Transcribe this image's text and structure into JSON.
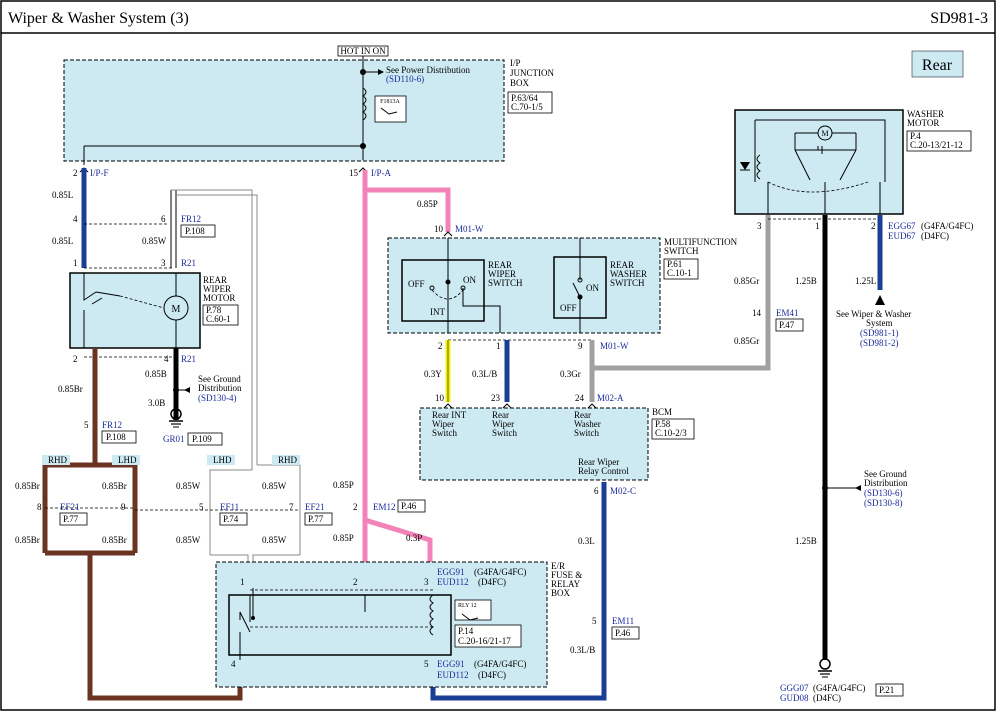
{
  "header": {
    "title": "Wiper & Washer System (3)",
    "code": "SD981-3"
  },
  "rear_label": "Rear",
  "hot_in_on": "HOT IN ON",
  "ip_box": {
    "name": [
      "I/P",
      "JUNCTION",
      "BOX"
    ],
    "ref": [
      "P.63/64",
      "C.70-1/5"
    ],
    "fuse": "F1813A",
    "see_power": "See Power Distribution",
    "see_power_ref": "(SD110-6)"
  },
  "pins": {
    "ipf": "I/P-F",
    "ipa": "I/P-A",
    "fr12_top": "FR12",
    "r21_top": "R21",
    "r21_bot": "R21",
    "fr12_bot": "FR12",
    "m01w_top": "M01-W",
    "m01w_bot": "M01-W",
    "em41": "EM41",
    "m02a": "M02-A",
    "m02c": "M02-C",
    "ef21_l": "EF21",
    "ef11": "EF11",
    "ef21_r": "EF21",
    "em12": "EM12",
    "em11": "EM11",
    "egg67": "EGG67",
    "egg67_v": "(G4FA/G4FC)",
    "eud67": "EUD67",
    "eud67_v": "(D4FC)",
    "egg91_top": "EGG91",
    "egg91_top_v": "(G4FA/G4FC)",
    "eud112_top": "EUD112",
    "eud112_top_v": "(D4FC)",
    "egg91_bot": "EGG91",
    "egg91_bot_v": "(G4FA/G4FC)",
    "eud112_bot": "EUD112",
    "eud112_bot_v": "(D4FC)",
    "ggg07": "GGG07",
    "ggg07_v": "(G4FA/G4FC)",
    "gud08": "GUD08",
    "gud08_v": "(D4FC)",
    "gr01": "GR01"
  },
  "refs": {
    "p108_top": "P.108",
    "p108_bot": "P.108",
    "p47": "P.47",
    "p109": "P.109",
    "p77_l": "P.77",
    "p74": "P.74",
    "p77_r": "P.77",
    "p46_top": "P.46",
    "p46_bot": "P.46",
    "p21": "P.21"
  },
  "numbers": [
    "2",
    "15",
    "4",
    "6",
    "1",
    "3",
    "2",
    "4",
    "5",
    "10",
    "2",
    "1",
    "9",
    "10",
    "23",
    "24",
    "6",
    "3",
    "1",
    "2",
    "14",
    "8",
    "9",
    "5",
    "7",
    "2",
    "1",
    "2",
    "3",
    "4",
    "5",
    "5",
    "RHD",
    "LHD",
    "LHD",
    "RHD"
  ],
  "wires": {
    "w085L_a": "0.85L",
    "w085L_b": "0.85L",
    "w085W_a": "0.85W",
    "w085B": "0.85B",
    "w30B": "3.0B",
    "w085Br_a": "0.85Br",
    "w085P_a": "0.85P",
    "w03Y": "0.3Y",
    "w03LB_a": "0.3L/B",
    "w03Gr": "0.3Gr",
    "w085Gr_a": "0.85Gr",
    "w085Gr_b": "0.85Gr",
    "w125B_a": "1.25B",
    "w125L": "1.25L",
    "w125B_b": "1.25B",
    "w03L": "0.3L",
    "w03LB_b": "0.3L/B",
    "w085Br_b": "0.85Br",
    "w085Br_c": "0.85Br",
    "w085W_b": "0.85W",
    "w085W_c": "0.85W",
    "w085Br_d": "0.85Br",
    "w085Br_e": "0.85Br",
    "w085W_d": "0.85W",
    "w085W_e": "0.85W",
    "w085P_b": "0.85P",
    "w085P_c": "0.85P",
    "w03P": "0.3P"
  },
  "motor": {
    "name": [
      "REAR",
      "WIPER",
      "MOTOR"
    ],
    "ref": [
      "P.78",
      "C.60-1"
    ],
    "m": "M"
  },
  "ground1": {
    "see": [
      "See Ground",
      "Distribution"
    ],
    "ref": "(SD130-4)"
  },
  "multifunction": {
    "name": [
      "MULTIFUNCTION",
      "SWITCH"
    ],
    "ref": [
      "P.61",
      "C.10-1"
    ],
    "wiper_sw": [
      "REAR",
      "WIPER",
      "SWITCH"
    ],
    "washer_sw": [
      "REAR",
      "WASHER",
      "SWITCH"
    ],
    "off": "OFF",
    "on": "ON",
    "int": "INT",
    "off2": "OFF",
    "on2": "ON"
  },
  "bcm": {
    "name": "BCM",
    "ref": [
      "P.58",
      "C.10-2/3"
    ],
    "col1": [
      "Rear INT",
      "Wiper",
      "Switch"
    ],
    "col2": [
      "Rear",
      "Wiper",
      "Switch"
    ],
    "col3": [
      "Rear",
      "Washer",
      "Switch"
    ],
    "relay_ctrl": [
      "Rear Wiper",
      "Relay Control"
    ]
  },
  "washer": {
    "name": [
      "WASHER",
      "MOTOR"
    ],
    "ref": [
      "P.4",
      "C.20-13/21-12"
    ],
    "m": "M",
    "see": [
      "See Wiper & Washer",
      "System"
    ],
    "see_ref": [
      "(SD981-1)",
      "(SD981-2)"
    ]
  },
  "ground2": {
    "see": [
      "See Ground",
      "Distribution"
    ],
    "ref": [
      "(SD130-6)",
      "(SD130-8)"
    ]
  },
  "er_box": {
    "name": [
      "E/R",
      "FUSE &",
      "RELAY",
      "BOX"
    ],
    "relay": "RLY 12",
    "ref": [
      "P.14",
      "C.20-16/21-17"
    ]
  }
}
